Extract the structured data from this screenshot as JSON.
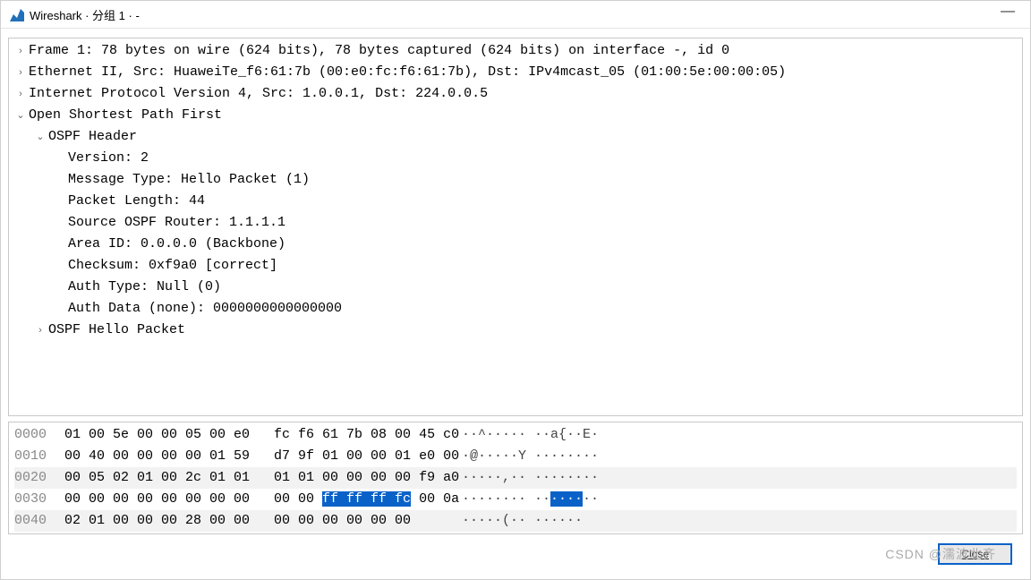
{
  "window": {
    "title": "Wireshark · 分组 1 · -",
    "minimize": "—"
  },
  "tree": [
    {
      "indent": 0,
      "twisty": ">",
      "expandable": true,
      "label": "Frame 1: 78 bytes on wire (624 bits), 78 bytes captured (624 bits) on interface -, id 0"
    },
    {
      "indent": 0,
      "twisty": ">",
      "expandable": true,
      "label": "Ethernet II, Src: HuaweiTe_f6:61:7b (00:e0:fc:f6:61:7b), Dst: IPv4mcast_05 (01:00:5e:00:00:05)"
    },
    {
      "indent": 0,
      "twisty": ">",
      "expandable": true,
      "label": "Internet Protocol Version 4, Src: 1.0.0.1, Dst: 224.0.0.5"
    },
    {
      "indent": 0,
      "twisty": "v",
      "expandable": true,
      "label": "Open Shortest Path First"
    },
    {
      "indent": 1,
      "twisty": "v",
      "expandable": true,
      "label": "OSPF Header"
    },
    {
      "indent": 2,
      "twisty": "",
      "expandable": false,
      "label": "Version: 2"
    },
    {
      "indent": 2,
      "twisty": "",
      "expandable": false,
      "label": "Message Type: Hello Packet (1)"
    },
    {
      "indent": 2,
      "twisty": "",
      "expandable": false,
      "label": "Packet Length: 44"
    },
    {
      "indent": 2,
      "twisty": "",
      "expandable": false,
      "label": "Source OSPF Router: 1.1.1.1"
    },
    {
      "indent": 2,
      "twisty": "",
      "expandable": false,
      "label": "Area ID: 0.0.0.0 (Backbone)"
    },
    {
      "indent": 2,
      "twisty": "",
      "expandable": false,
      "label": "Checksum: 0xf9a0 [correct]"
    },
    {
      "indent": 2,
      "twisty": "",
      "expandable": false,
      "label": "Auth Type: Null (0)"
    },
    {
      "indent": 2,
      "twisty": "",
      "expandable": false,
      "label": "Auth Data (none): 0000000000000000"
    },
    {
      "indent": 1,
      "twisty": ">",
      "expandable": true,
      "label": "OSPF Hello Packet"
    }
  ],
  "hex": [
    {
      "off": "0000",
      "h1": "01 00 5e 00 00 05 00 e0",
      "h2": "fc f6 61 7b 08 00 45 c0",
      "a1": "··^·····",
      "a2": "··a{··E·",
      "alt": false
    },
    {
      "off": "0010",
      "h1": "00 40 00 00 00 00 01 59",
      "h2": "d7 9f 01 00 00 01 e0 00",
      "a1": "·@·····Y",
      "a2": "········",
      "alt": false
    },
    {
      "off": "0020",
      "h1": "00 05 02 01 00 2c 01 01",
      "h2": "01 01 00 00 00 00 f9 a0",
      "a1": "·····,··",
      "a2": "········",
      "alt": true
    },
    {
      "off": "0030",
      "h1": "00 00 00 00 00 00 00 00",
      "h2a": "00 00 ",
      "h2b": "ff ff ff fc",
      "h2c": " 00 0a",
      "a1": "········",
      "a2a": "··",
      "a2b": "····",
      "a2c": "··",
      "alt": false,
      "highlight": true
    },
    {
      "off": "0040",
      "h1": "02 01 00 00 00 28 00 00",
      "h2": "00 00 00 00 00 00",
      "a1": "·····(··",
      "a2": "······",
      "alt": true
    }
  ],
  "footer": {
    "close": "Close",
    "watermark": "CSDN @濡波北齐"
  }
}
